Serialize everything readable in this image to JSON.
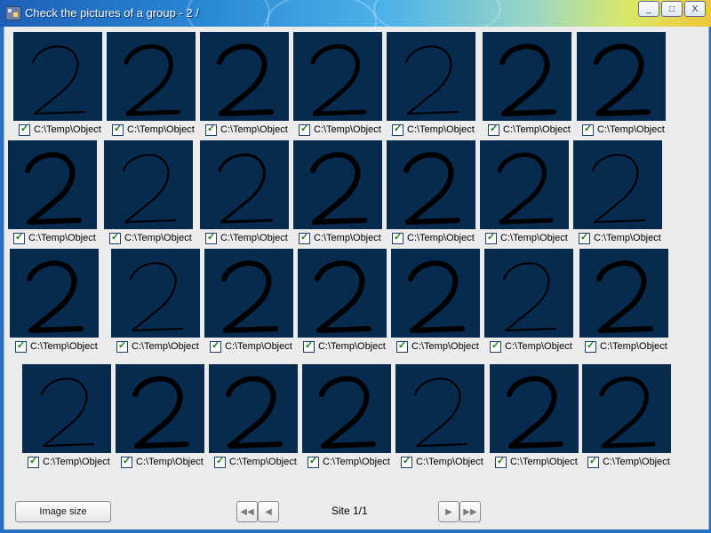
{
  "window": {
    "title": "Check the pictures of a group - 2 /",
    "minimize_icon": "minimize-icon",
    "maximize_icon": "maximize-icon",
    "close_icon": "close-icon"
  },
  "thumbnails": {
    "caption": "C:\\Temp\\Object",
    "checkbox_state": "checked",
    "count": 28
  },
  "footer": {
    "image_size_label": "Image size",
    "page_label": "Site 1/1",
    "first_icon": "first-page-icon",
    "prev_icon": "prev-page-icon",
    "next_icon": "next-page-icon",
    "last_icon": "last-page-icon"
  },
  "colors": {
    "thumb_bg": "#072a4f",
    "stroke": "#000000"
  }
}
